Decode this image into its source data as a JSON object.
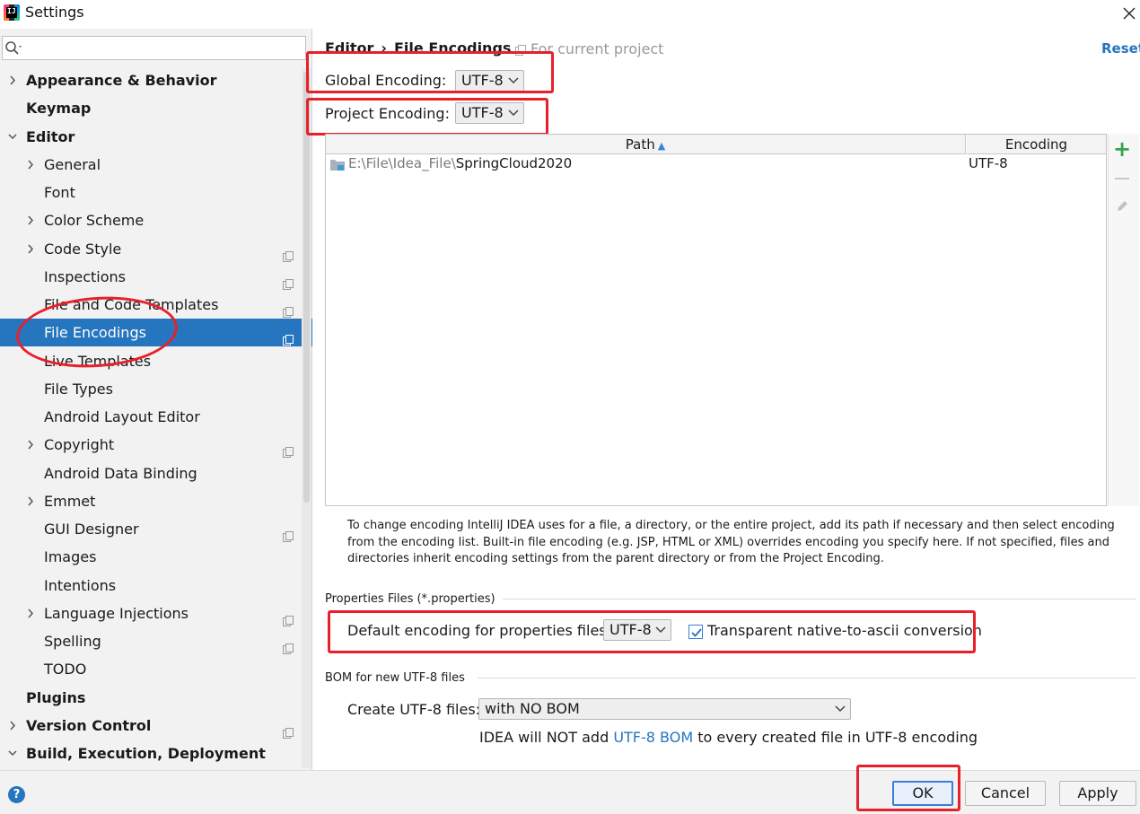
{
  "window": {
    "title": "Settings"
  },
  "search": {
    "placeholder": ""
  },
  "sidebar": {
    "items": [
      {
        "label": "Appearance & Behavior",
        "level": 0,
        "expander": "collapsed",
        "bold": true,
        "project": false,
        "selected": false
      },
      {
        "label": "Keymap",
        "level": 0,
        "expander": "none",
        "bold": true,
        "project": false,
        "selected": false
      },
      {
        "label": "Editor",
        "level": 0,
        "expander": "expanded",
        "bold": true,
        "project": false,
        "selected": false
      },
      {
        "label": "General",
        "level": 1,
        "expander": "collapsed",
        "bold": false,
        "project": false,
        "selected": false
      },
      {
        "label": "Font",
        "level": 1,
        "expander": "none",
        "bold": false,
        "project": false,
        "selected": false
      },
      {
        "label": "Color Scheme",
        "level": 1,
        "expander": "collapsed",
        "bold": false,
        "project": false,
        "selected": false
      },
      {
        "label": "Code Style",
        "level": 1,
        "expander": "collapsed",
        "bold": false,
        "project": true,
        "selected": false
      },
      {
        "label": "Inspections",
        "level": 1,
        "expander": "none",
        "bold": false,
        "project": true,
        "selected": false
      },
      {
        "label": "File and Code Templates",
        "level": 1,
        "expander": "none",
        "bold": false,
        "project": true,
        "selected": false
      },
      {
        "label": "File Encodings",
        "level": 1,
        "expander": "none",
        "bold": false,
        "project": true,
        "selected": true
      },
      {
        "label": "Live Templates",
        "level": 1,
        "expander": "none",
        "bold": false,
        "project": false,
        "selected": false
      },
      {
        "label": "File Types",
        "level": 1,
        "expander": "none",
        "bold": false,
        "project": false,
        "selected": false
      },
      {
        "label": "Android Layout Editor",
        "level": 1,
        "expander": "none",
        "bold": false,
        "project": false,
        "selected": false
      },
      {
        "label": "Copyright",
        "level": 1,
        "expander": "collapsed",
        "bold": false,
        "project": true,
        "selected": false
      },
      {
        "label": "Android Data Binding",
        "level": 1,
        "expander": "none",
        "bold": false,
        "project": false,
        "selected": false
      },
      {
        "label": "Emmet",
        "level": 1,
        "expander": "collapsed",
        "bold": false,
        "project": false,
        "selected": false
      },
      {
        "label": "GUI Designer",
        "level": 1,
        "expander": "none",
        "bold": false,
        "project": true,
        "selected": false
      },
      {
        "label": "Images",
        "level": 1,
        "expander": "none",
        "bold": false,
        "project": false,
        "selected": false
      },
      {
        "label": "Intentions",
        "level": 1,
        "expander": "none",
        "bold": false,
        "project": false,
        "selected": false
      },
      {
        "label": "Language Injections",
        "level": 1,
        "expander": "collapsed",
        "bold": false,
        "project": true,
        "selected": false
      },
      {
        "label": "Spelling",
        "level": 1,
        "expander": "none",
        "bold": false,
        "project": true,
        "selected": false
      },
      {
        "label": "TODO",
        "level": 1,
        "expander": "none",
        "bold": false,
        "project": false,
        "selected": false
      },
      {
        "label": "Plugins",
        "level": 0,
        "expander": "none",
        "bold": true,
        "project": false,
        "selected": false
      },
      {
        "label": "Version Control",
        "level": 0,
        "expander": "collapsed",
        "bold": true,
        "project": true,
        "selected": false
      },
      {
        "label": "Build, Execution, Deployment",
        "level": 0,
        "expander": "expanded",
        "bold": true,
        "project": false,
        "selected": false
      }
    ]
  },
  "header": {
    "breadcrumb_parent": "Editor",
    "breadcrumb_sep": "›",
    "breadcrumb_current": "File Encodings",
    "scope_label": "For current project",
    "reset_label": "Reset"
  },
  "global_encoding": {
    "label": "Global Encoding:",
    "value": "UTF-8"
  },
  "project_encoding": {
    "label": "Project Encoding:",
    "value": "UTF-8"
  },
  "table": {
    "columns": [
      "Path",
      "Encoding"
    ],
    "sort_indicator": "▲",
    "rows": [
      {
        "path_prefix": "E:\\File\\Idea_File\\",
        "path_name": "SpringCloud2020",
        "encoding": "UTF-8"
      }
    ],
    "add_label": "+"
  },
  "help_text": "To change encoding IntelliJ IDEA uses for a file, a directory, or the entire project, add its path if necessary and then select encoding from the encoding list. Built-in file encoding (e.g. JSP, HTML or XML) overrides encoding you specify here. If not specified, files and directories inherit encoding settings from the parent directory or from the Project Encoding.",
  "properties": {
    "section_title": "Properties Files (*.properties)",
    "label": "Default encoding for properties files:",
    "value": "UTF-8",
    "checkbox_label": "Transparent native-to-ascii conversion",
    "checkbox_checked": true
  },
  "bom": {
    "section_title": "BOM for new UTF-8 files",
    "label": "Create UTF-8 files:",
    "value": "with NO BOM",
    "note_prefix": "IDEA will NOT add ",
    "note_link": "UTF-8 BOM",
    "note_suffix": " to every created file in UTF-8 encoding"
  },
  "footer": {
    "help_label": "?",
    "ok_label": "OK",
    "cancel_label": "Cancel",
    "apply_label": "Apply"
  },
  "colors": {
    "selection": "#2675bf",
    "annotation_red": "#e8202a",
    "link": "#2675bf",
    "add_green": "#3aa24a"
  }
}
